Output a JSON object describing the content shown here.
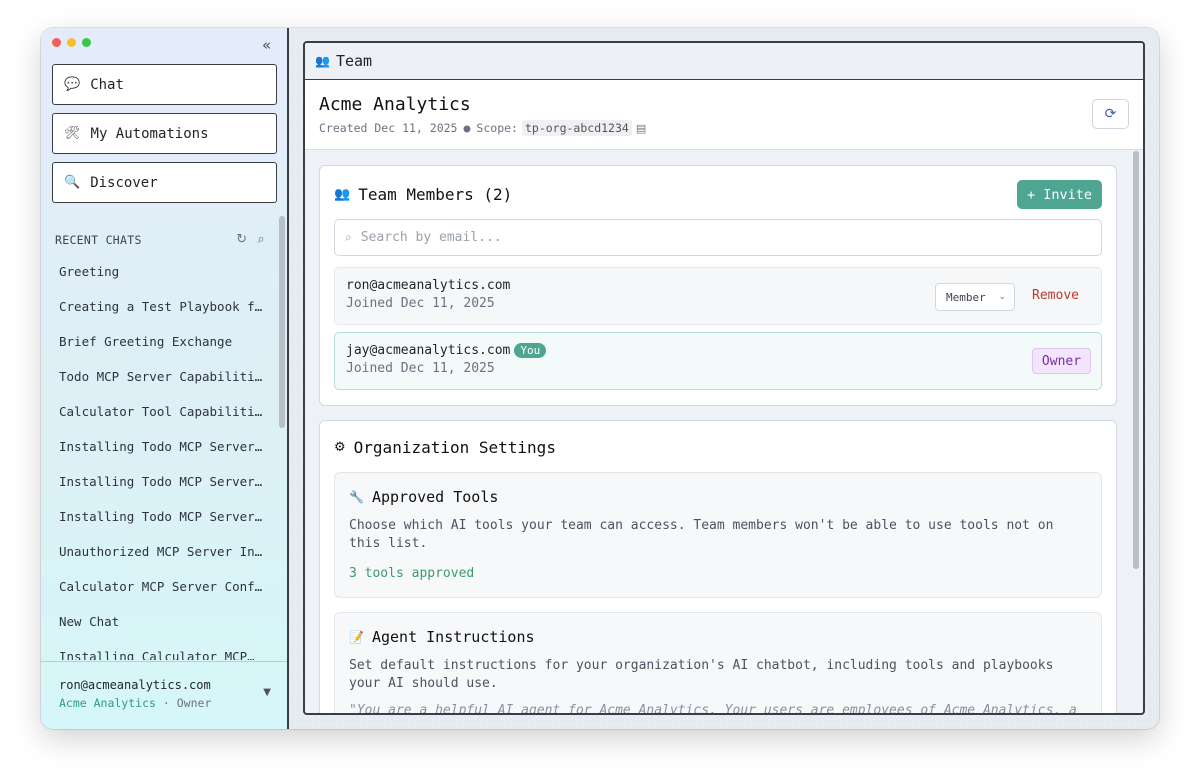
{
  "sidebar": {
    "nav": [
      {
        "label": "Chat",
        "icon": "💬"
      },
      {
        "label": "My Automations",
        "icon": "🛠"
      },
      {
        "label": "Discover",
        "icon": "🔍"
      }
    ],
    "recent_header": "RECENT CHATS",
    "recent_chats": [
      "Greeting",
      "Creating a Test Playbook f…",
      "Brief Greeting Exchange",
      "Todo MCP Server Capabiliti…",
      "Calculator Tool Capabiliti…",
      "Installing Todo MCP Server…",
      "Installing Todo MCP Server…",
      "Installing Todo MCP Server…",
      "Unauthorized MCP Server In…",
      "Calculator MCP Server Conf…",
      "New Chat",
      "Installing Calculator MCP…"
    ],
    "user": {
      "email": "ron@acmeanalytics.com",
      "org": "Acme Analytics",
      "separator": "·",
      "role": "Owner"
    }
  },
  "panel": {
    "title": "Team",
    "title_icon": "👥"
  },
  "org": {
    "name": "Acme Analytics",
    "created": "Created Dec 11, 2025",
    "bullet": "●",
    "scope_label": "Scope:",
    "scope_value": "tp-org-abcd1234"
  },
  "members_card": {
    "title": "Team Members (2)",
    "icon": "👥",
    "invite_label": "+ Invite",
    "search_placeholder": "Search by email...",
    "members": [
      {
        "email": "ron@acmeanalytics.com",
        "joined": "Joined Dec 11, 2025",
        "role": "Member",
        "remove": "Remove"
      },
      {
        "email": "jay@acmeanalytics.com",
        "joined": "Joined Dec 11, 2025",
        "you": "You",
        "role": "Owner"
      }
    ]
  },
  "settings_card": {
    "title": "Organization Settings",
    "icon": "⚙",
    "approved_tools": {
      "icon": "🔧",
      "title": "Approved Tools",
      "desc": "Choose which AI tools your team can access. Team members won't be able to use tools not on this list.",
      "count": "3 tools approved"
    },
    "agent_instructions": {
      "icon": "📝",
      "title": "Agent Instructions",
      "desc": "Set default instructions for your organization's AI chatbot, including tools and playbooks your AI should use.",
      "quote": "\"You are a helpful AI agent for Acme Analytics. Your users are employees of Acme Analytics, a"
    }
  }
}
